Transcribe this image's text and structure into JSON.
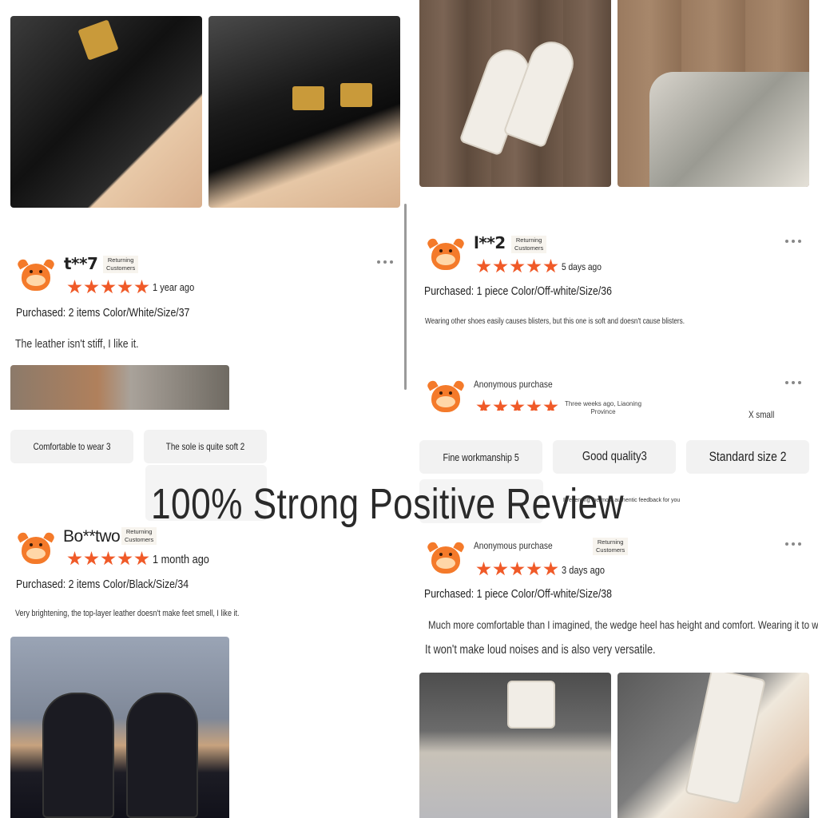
{
  "overlay": {
    "title": "100% Strong Positive Review",
    "subtitle": "Presenting the most authentic feedback for you"
  },
  "reviews": [
    {
      "username": "t**7",
      "badge_line1": "Returning",
      "badge_line2": "Customers",
      "rating": 5,
      "time": "1 year ago",
      "purchased": "Purchased: 2 items Color/White/Size/37",
      "text": "The leather isn't stiff, I like it."
    },
    {
      "username": "l**2",
      "badge_line1": "Returning",
      "badge_line2": "Customers",
      "rating": 5,
      "time": "5 days ago",
      "purchased": "Purchased: 1 piece Color/Off-white/Size/36",
      "text": "Wearing other shoes easily causes blisters, but this one is soft and doesn't cause blisters."
    },
    {
      "username": "Anonymous purchase",
      "rating": 5,
      "time_line1": "Three weeks ago, Liaoning",
      "time_line2": "Province",
      "size_note": "X small"
    },
    {
      "username": "Bo**two",
      "badge_line1": "Returning",
      "badge_line2": "Customers",
      "rating": 5,
      "time": "1 month ago",
      "purchased": "Purchased: 2 items Color/Black/Size/34",
      "text": "Very brightening, the top-layer leather doesn't make feet smell, I like it."
    },
    {
      "username": "Anonymous purchase",
      "badge_line1": "Returning",
      "badge_line2": "Customers",
      "rating": 5,
      "time": "3 days ago",
      "purchased": "Purchased: 1 piece Color/Off-white/Size/38",
      "text_line1": "Much more comfortable than I imagined, the wedge heel has height and comfort. Wearing it to walk",
      "text_line2": "It won't make loud noises and is also very versatile."
    }
  ],
  "tags_left": [
    "Comfortable to wear 3",
    "The sole is quite soft 2"
  ],
  "tags_right": [
    "Fine workmanship 5",
    "Good quality3",
    "Standard size 2"
  ],
  "colors": {
    "star": "#f05a28",
    "avatar": "#f47a2a",
    "tag_bg": "#f2f2f2"
  }
}
